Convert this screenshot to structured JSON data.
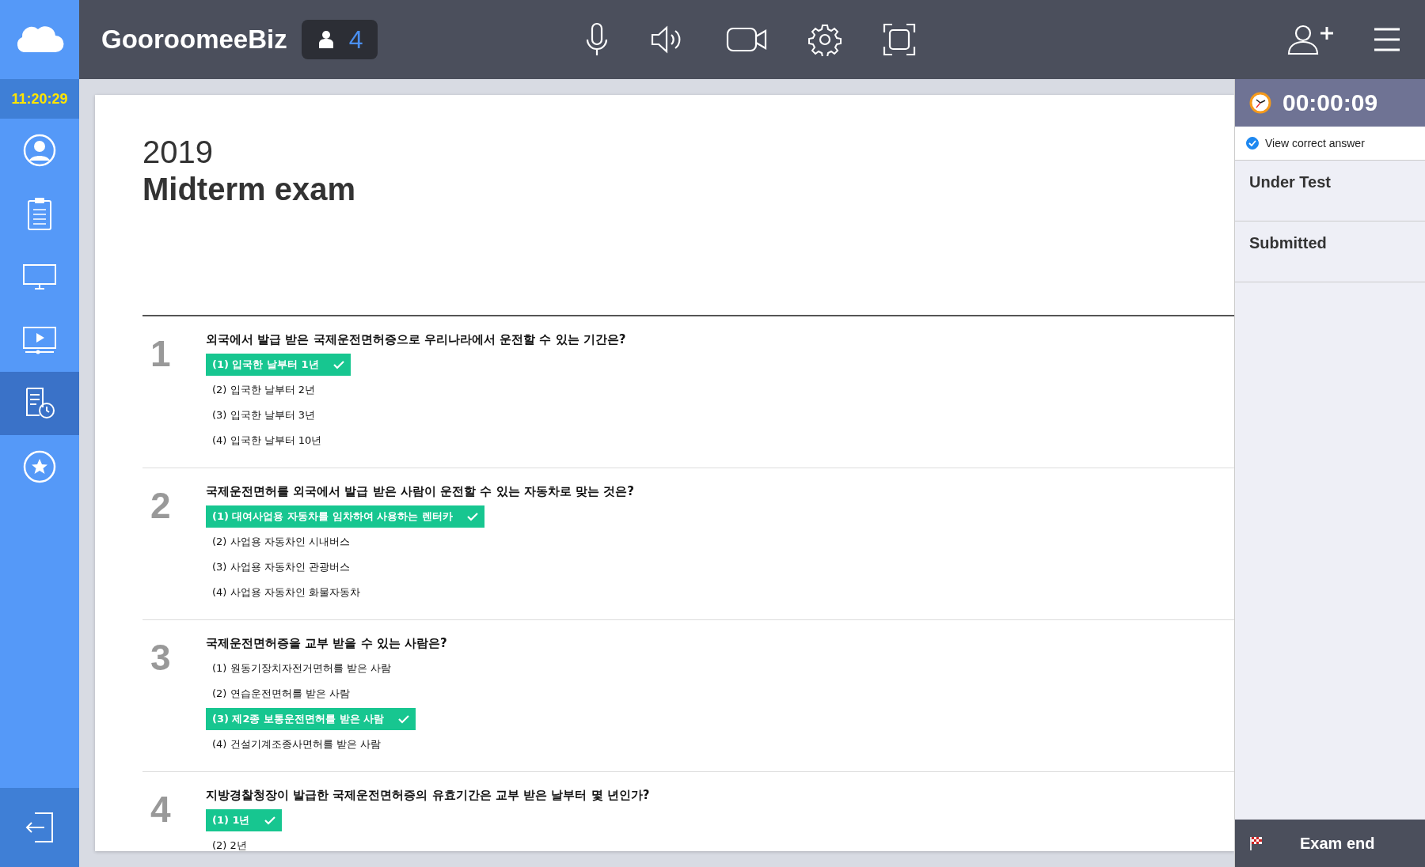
{
  "topbar": {
    "brand": "GooroomeeBiz",
    "participants": "4"
  },
  "sidebar": {
    "clock": "11:20:29",
    "items": [
      {
        "kind": "profile",
        "selected": false
      },
      {
        "kind": "clipboard",
        "selected": false
      },
      {
        "kind": "monitor",
        "selected": false
      },
      {
        "kind": "video",
        "selected": false
      },
      {
        "kind": "exam",
        "selected": true
      },
      {
        "kind": "star",
        "selected": false
      }
    ]
  },
  "exam": {
    "year": "2019",
    "title": "Midterm exam",
    "questions": [
      {
        "number": "1",
        "text": "외국에서 발급 받은 국제운전면허증으로 우리나라에서 운전할 수 있는 기간은?",
        "options": [
          {
            "text": "(1) 입국한 날부터 1년",
            "correct": true
          },
          {
            "text": "(2) 입국한 날부터 2년",
            "correct": false
          },
          {
            "text": "(3) 입국한 날부터 3년",
            "correct": false
          },
          {
            "text": "(4) 입국한 날부터 10년",
            "correct": false
          }
        ]
      },
      {
        "number": "2",
        "text": "국제운전면허를 외국에서 발급 받은 사람이 운전할 수 있는 자동차로 맞는 것은?",
        "options": [
          {
            "text": "(1) 대여사업용 자동차를 임차하여 사용하는 렌터카",
            "correct": true
          },
          {
            "text": "(2) 사업용 자동차인 시내버스",
            "correct": false
          },
          {
            "text": "(3) 사업용 자동차인 관광버스",
            "correct": false
          },
          {
            "text": "(4) 사업용 자동차인 화물자동차",
            "correct": false
          }
        ]
      },
      {
        "number": "3",
        "text": "국제운전면허증을 교부 받을 수 있는 사람은?",
        "options": [
          {
            "text": "(1) 원동기장치자전거면허를 받은 사람",
            "correct": false
          },
          {
            "text": "(2) 연습운전면허를 받은 사람",
            "correct": false
          },
          {
            "text": "(3) 제2종 보통운전면허를 받은 사람",
            "correct": true
          },
          {
            "text": "(4) 건설기계조종사면허를 받은 사람",
            "correct": false
          }
        ]
      },
      {
        "number": "4",
        "text": "지방경찰청장이 발급한 국제운전면허증의 유효기간은 교부 받은 날부터 몇 년인가?",
        "options": [
          {
            "text": "(1) 1년",
            "correct": true
          },
          {
            "text": "(2) 2년",
            "correct": false
          }
        ]
      }
    ]
  },
  "panel": {
    "timer": "00:00:09",
    "view_correct": {
      "label": "View correct answer",
      "checked": true
    },
    "sections": [
      "Under Test",
      "Submitted"
    ],
    "end_button": "Exam end"
  }
}
